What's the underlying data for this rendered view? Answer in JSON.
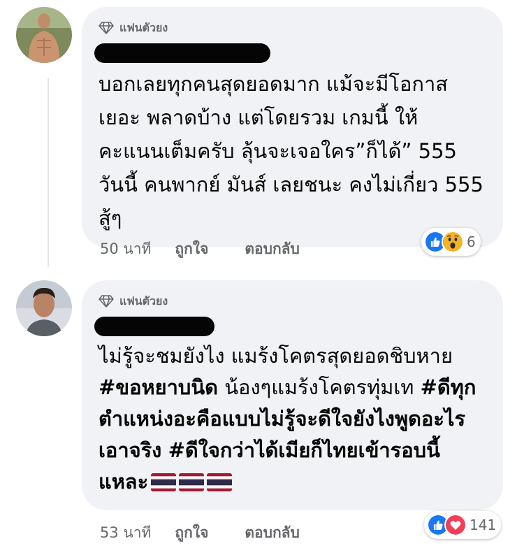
{
  "comments": [
    {
      "badge": "แฟนตัวยง",
      "text": "บอกเลยทุกคนสุดยอดมาก แม้จะมีโอกาส เยอะ พลาดบ้าง แต่โดยรวม เกมนี้ ให้ คะแนนเต็มครับ ลุ้นจะเจอใคร”ก็ได้” 555 วันนี้ คนพากย์ มันส์ เลยชนะ คงไม่เกี่ยว 555 สู้ๆ",
      "time": "50 นาที",
      "like_label": "ถูกใจ",
      "reply_label": "ตอบกลับ",
      "reactions": [
        "like-icon",
        "wow-icon"
      ],
      "reaction_count": "6"
    },
    {
      "badge": "แฟนตัวยง",
      "text_parts": [
        "ไม่รู้จะชมยังไง แมร้งโคตรสุดยอดชิบหาย ",
        "#ขอหยาบนิด",
        " น้องๆแมร้งโคตรทุ่มเท ",
        "#ดีทุกตำแหน่งอะคือแบบไม่รู้จะดีใจยังไงพูดอะไรเอาจริง",
        " ",
        "#ดีใจกว่าได้เมียก็ไทยเข้ารอบนี้แหละ"
      ],
      "flags": [
        "thai-flag-icon",
        "thai-flag-icon",
        "thai-flag-icon"
      ],
      "time": "53 นาที",
      "like_label": "ถูกใจ",
      "reply_label": "ตอบกลับ",
      "reactions": [
        "like-icon",
        "love-icon"
      ],
      "reaction_count": "141"
    }
  ],
  "colors": {
    "bubble": "#f0f2f5",
    "meta_text": "#65676b",
    "like_blue": "#1877f2",
    "love_red": "#f33e58",
    "wow_yellow": "#f7b125"
  }
}
